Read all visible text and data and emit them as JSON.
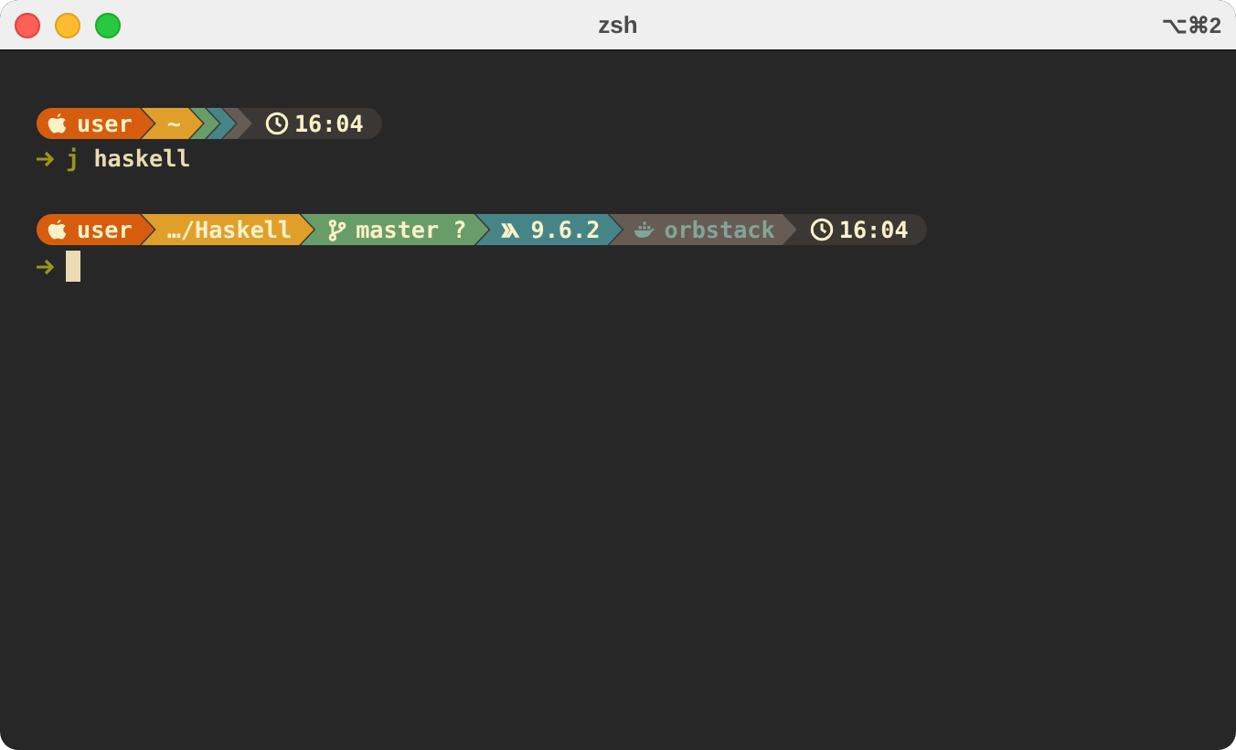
{
  "window": {
    "title": "zsh",
    "shortcut": "⌥⌘2"
  },
  "prompts": [
    {
      "segments": [
        {
          "kind": "user",
          "text": "user",
          "color": "#d65d0e"
        },
        {
          "kind": "path",
          "text": "~",
          "color": "#e09f2a"
        },
        {
          "kind": "git",
          "color": "#689d6a"
        },
        {
          "kind": "lang",
          "color": "#458588"
        },
        {
          "kind": "docker",
          "color": "#665c54"
        }
      ],
      "time": "16:04",
      "command": {
        "program": "j",
        "args": "haskell"
      }
    },
    {
      "segments": [
        {
          "kind": "user",
          "text": "user",
          "color": "#d65d0e"
        },
        {
          "kind": "path",
          "text": "…/Haskell",
          "color": "#e09f2a"
        },
        {
          "kind": "git",
          "text": "master ?",
          "color": "#689d6a"
        },
        {
          "kind": "lang",
          "text": "9.6.2",
          "color": "#458588"
        },
        {
          "kind": "docker",
          "text": "orbstack",
          "color": "#665c54"
        }
      ],
      "time": "16:04",
      "cursor": true
    }
  ]
}
